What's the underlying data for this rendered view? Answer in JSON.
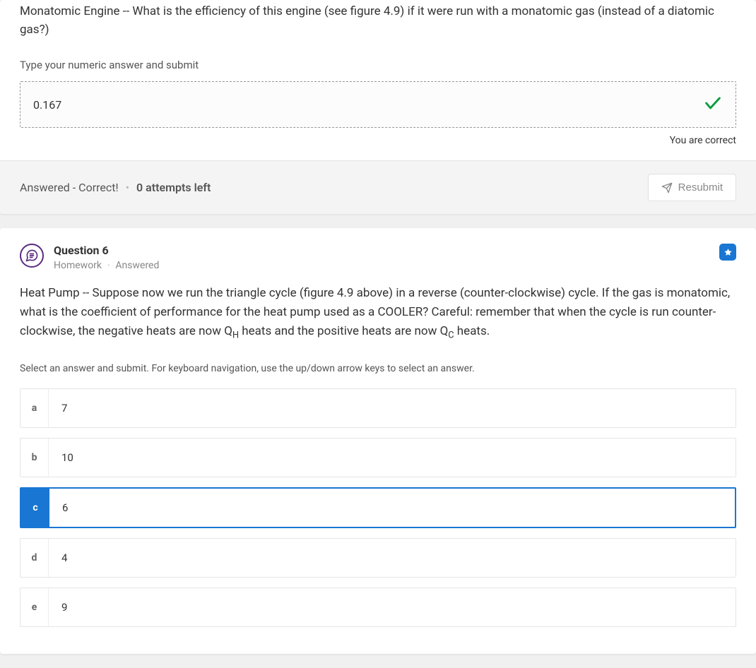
{
  "q5": {
    "prompt": "Monatomic Engine -- What is the efficiency of this engine (see figure 4.9) if it were run with a monatomic gas (instead of a diatomic gas?)",
    "instruction": "Type your numeric answer and submit",
    "answer_value": "0.167",
    "correct_note": "You are correct",
    "footer_status": "Answered - Correct!",
    "footer_attempts": "0 attempts left",
    "resubmit_label": "Resubmit"
  },
  "q6": {
    "title": "Question 6",
    "sub1": "Homework",
    "sub2": "Answered",
    "prompt_pre": "Heat Pump -- Suppose now we run the triangle cycle (figure 4.9 above) in a reverse (counter-clockwise) cycle. If the gas is monatomic, what is the coefficient of performance for the heat pump used as a COOLER? Careful: remember that when the cycle is run counter-clockwise, the negative heats are now Q",
    "prompt_mid1": " heats and the positive heats are now Q",
    "prompt_post": " heats.",
    "sub_h": "H",
    "sub_c": "C",
    "hint": "Select an answer and submit. For keyboard navigation, use the up/down arrow keys to select an answer.",
    "choices": [
      {
        "letter": "a",
        "value": "7"
      },
      {
        "letter": "b",
        "value": "10"
      },
      {
        "letter": "c",
        "value": "6"
      },
      {
        "letter": "d",
        "value": "4"
      },
      {
        "letter": "e",
        "value": "9"
      }
    ],
    "selected_index": 2
  }
}
